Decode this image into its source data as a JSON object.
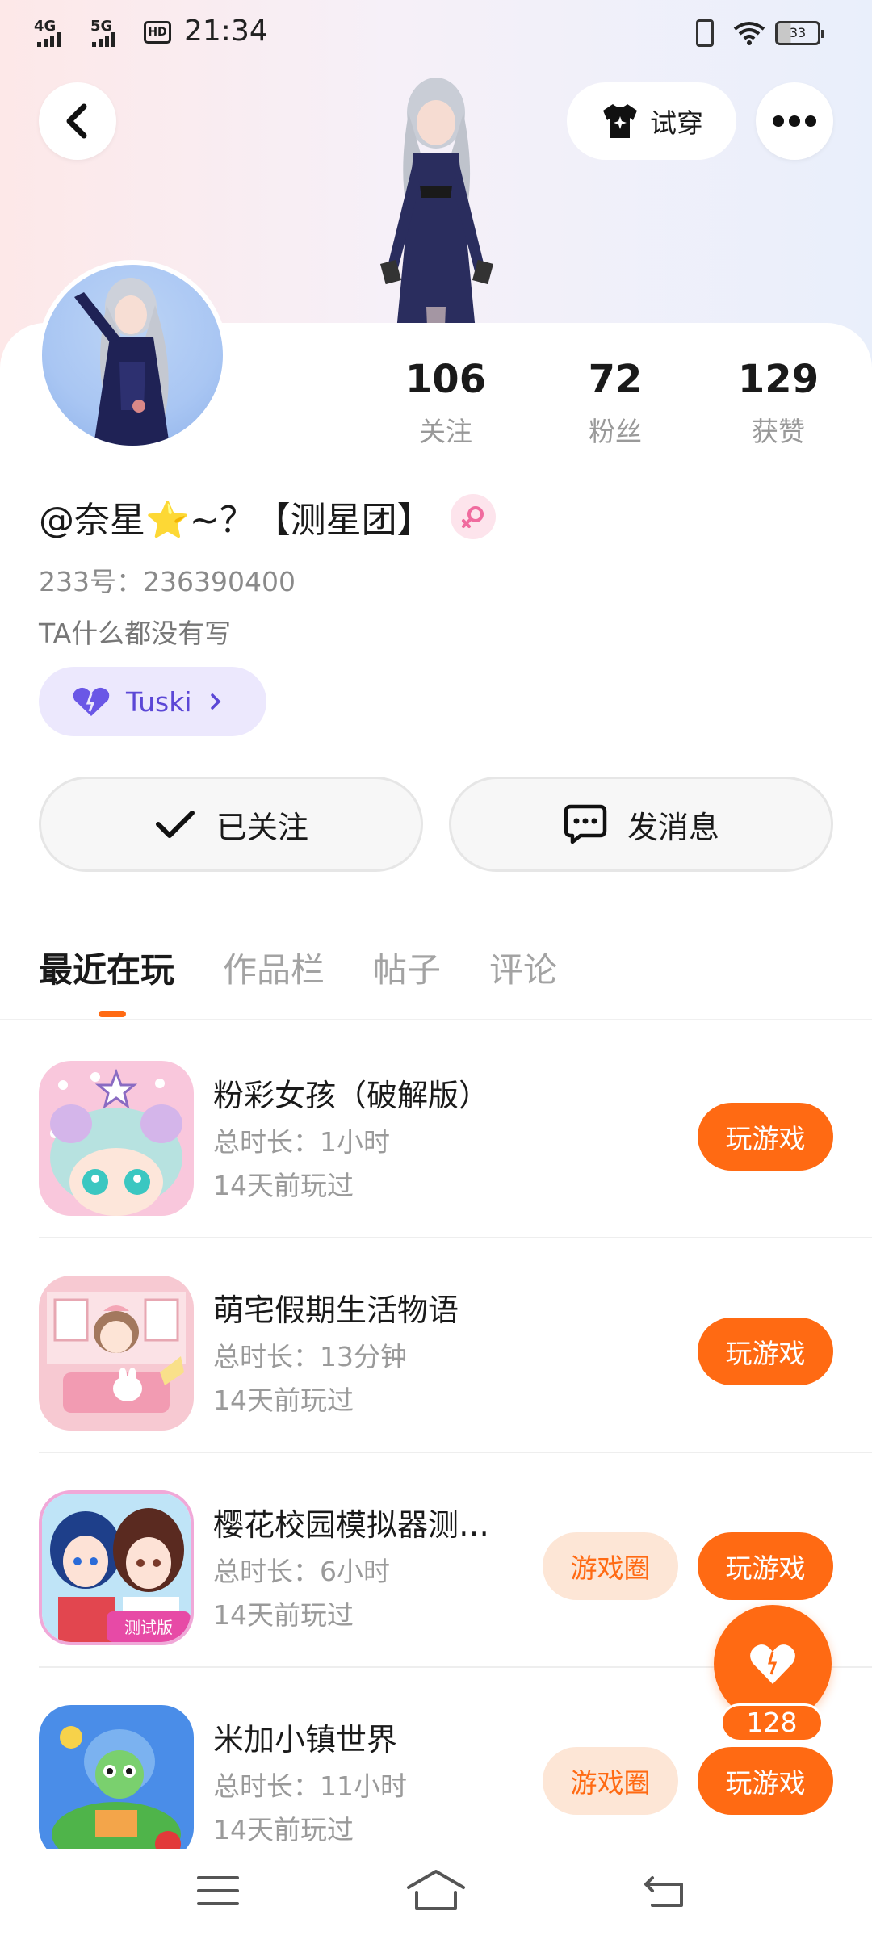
{
  "status_bar": {
    "network_1": "4G",
    "network_2": "5G",
    "hd": "HD",
    "time": "21:34",
    "battery": "33"
  },
  "header": {
    "try_on_label": "试穿"
  },
  "profile": {
    "stats": [
      {
        "value": "106",
        "label": "关注"
      },
      {
        "value": "72",
        "label": "粉丝"
      },
      {
        "value": "129",
        "label": "获赞"
      }
    ],
    "name": "@奈星⭐~？【测星团】",
    "uid": "233号：236390400",
    "bio": "TA什么都没有写",
    "tag_label": "Tuski",
    "follow_label": "已关注",
    "message_label": "发消息"
  },
  "tabs": [
    {
      "label": "最近在玩"
    },
    {
      "label": "作品栏"
    },
    {
      "label": "帖子"
    },
    {
      "label": "评论"
    }
  ],
  "games": [
    {
      "title": "粉彩女孩（破解版）",
      "duration": "总时长：1小时",
      "last_played": "14天前玩过",
      "play_label": "玩游戏",
      "circle_label": ""
    },
    {
      "title": "萌宅假期生活物语",
      "duration": "总时长：13分钟",
      "last_played": "14天前玩过",
      "play_label": "玩游戏",
      "circle_label": ""
    },
    {
      "title": "樱花校园模拟器测…",
      "duration": "总时长：6小时",
      "last_played": "14天前玩过",
      "play_label": "玩游戏",
      "circle_label": "游戏圈",
      "icon_badge": "测试版"
    },
    {
      "title": "米加小镇世界",
      "duration": "总时长：11小时",
      "last_played": "14天前玩过",
      "play_label": "玩游戏",
      "circle_label": "游戏圈"
    }
  ],
  "fab": {
    "count": "128"
  },
  "colors": {
    "accent": "#ff6a13",
    "accent_soft": "#fde6d6",
    "tag_bg": "#ece8fd",
    "tag_text": "#5b47d6"
  }
}
